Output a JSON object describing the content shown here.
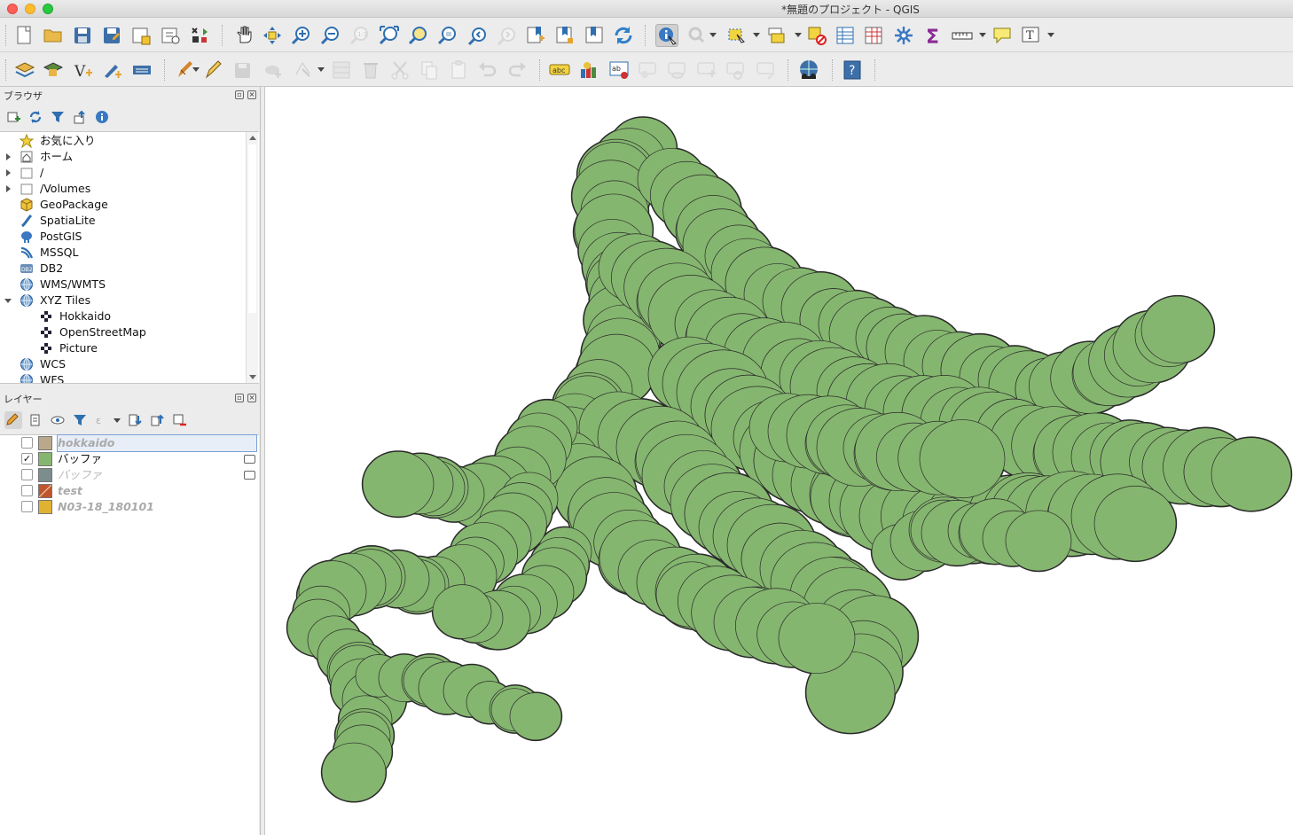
{
  "window": {
    "title": "*無題のプロジェクト - QGIS"
  },
  "toolbar_main": {
    "icons": [
      "new-project-icon",
      "open-project-icon",
      "save-project-icon",
      "save-as-icon",
      "print-layout-icon",
      "layout-manager-icon",
      "style-manager-icon",
      "pan-icon",
      "pan-to-selection-icon",
      "zoom-in-icon",
      "zoom-out-icon",
      "zoom-native-icon",
      "zoom-full-icon",
      "zoom-to-selection-icon",
      "zoom-to-layer-icon",
      "zoom-last-icon",
      "zoom-next-icon",
      "new-bookmark-icon",
      "show-bookmarks-icon",
      "temporal-icon",
      "refresh-icon",
      "identify-icon",
      "action-icon",
      "select-features-icon",
      "select-by-value-icon",
      "deselect-icon",
      "attribute-table-icon",
      "field-calculator-icon",
      "processing-icon",
      "statistics-icon",
      "measure-icon",
      "map-tips-icon",
      "text-annotation-icon"
    ]
  },
  "toolbar_edit": {
    "icons": [
      "add-vector-layer-icon",
      "add-raster-layer-icon",
      "new-shapefile-icon",
      "digitize-icon",
      "add-delimited-text-icon",
      "current-edits-icon",
      "toggle-editing-icon",
      "save-edits-icon",
      "add-feature-icon",
      "vertex-tool-icon",
      "modify-attributes-icon",
      "delete-selected-icon",
      "cut-features-icon",
      "copy-features-icon",
      "paste-features-icon",
      "undo-icon",
      "redo-icon",
      "label-toolbar-icon",
      "diagram-icon",
      "highlight-label-icon",
      "pin-label-icon",
      "show-hide-labels-icon",
      "move-label-icon",
      "rotate-label-icon",
      "change-label-icon",
      "plugin-globe-icon",
      "help-icon"
    ]
  },
  "browser_panel": {
    "title": "ブラウザ",
    "items": [
      {
        "label": "お気に入り",
        "icon": "star-icon",
        "indent": 0,
        "arrow": "none"
      },
      {
        "label": "ホーム",
        "icon": "home-icon",
        "indent": 0,
        "arrow": "right"
      },
      {
        "label": "/",
        "icon": "folder-icon",
        "indent": 0,
        "arrow": "right"
      },
      {
        "label": "/Volumes",
        "icon": "folder-icon",
        "indent": 0,
        "arrow": "right"
      },
      {
        "label": "GeoPackage",
        "icon": "geopackage-icon",
        "indent": 0,
        "arrow": "none"
      },
      {
        "label": "SpatiaLite",
        "icon": "spatialite-icon",
        "indent": 0,
        "arrow": "none"
      },
      {
        "label": "PostGIS",
        "icon": "postgis-icon",
        "indent": 0,
        "arrow": "none"
      },
      {
        "label": "MSSQL",
        "icon": "mssql-icon",
        "indent": 0,
        "arrow": "none"
      },
      {
        "label": "DB2",
        "icon": "db2-icon",
        "indent": 0,
        "arrow": "none"
      },
      {
        "label": "WMS/WMTS",
        "icon": "globe-icon",
        "indent": 0,
        "arrow": "none"
      },
      {
        "label": "XYZ Tiles",
        "icon": "globe-icon",
        "indent": 0,
        "arrow": "down"
      },
      {
        "label": "Hokkaido",
        "icon": "tiles-icon",
        "indent": 1,
        "arrow": "none"
      },
      {
        "label": "OpenStreetMap",
        "icon": "tiles-icon",
        "indent": 1,
        "arrow": "none"
      },
      {
        "label": "Picture",
        "icon": "tiles-icon",
        "indent": 1,
        "arrow": "none"
      },
      {
        "label": "WCS",
        "icon": "globe-icon",
        "indent": 0,
        "arrow": "none"
      },
      {
        "label": "WFS",
        "icon": "globe-icon",
        "indent": 0,
        "arrow": "none"
      }
    ]
  },
  "layers_panel": {
    "title": "レイヤー",
    "layers": [
      {
        "name": "hokkaido",
        "checked": false,
        "color": "#bba88c",
        "style": "off",
        "selected": true,
        "memory": false
      },
      {
        "name": "バッファ",
        "checked": true,
        "color": "#85b66f",
        "style": "on",
        "selected": false,
        "memory": true
      },
      {
        "name": "バッファ",
        "checked": false,
        "color": "#7d8c8c",
        "style": "off2",
        "selected": false,
        "memory": true
      },
      {
        "name": "test",
        "checked": false,
        "color": "#c0552c",
        "style": "off",
        "selected": false,
        "memory": false
      },
      {
        "name": "N03-18_180101",
        "checked": false,
        "color": "#e0b232",
        "style": "off",
        "selected": false,
        "memory": false
      }
    ]
  },
  "map": {
    "fill": "#85b66f",
    "stroke": "#2a2a2a",
    "background": "#ffffff"
  }
}
